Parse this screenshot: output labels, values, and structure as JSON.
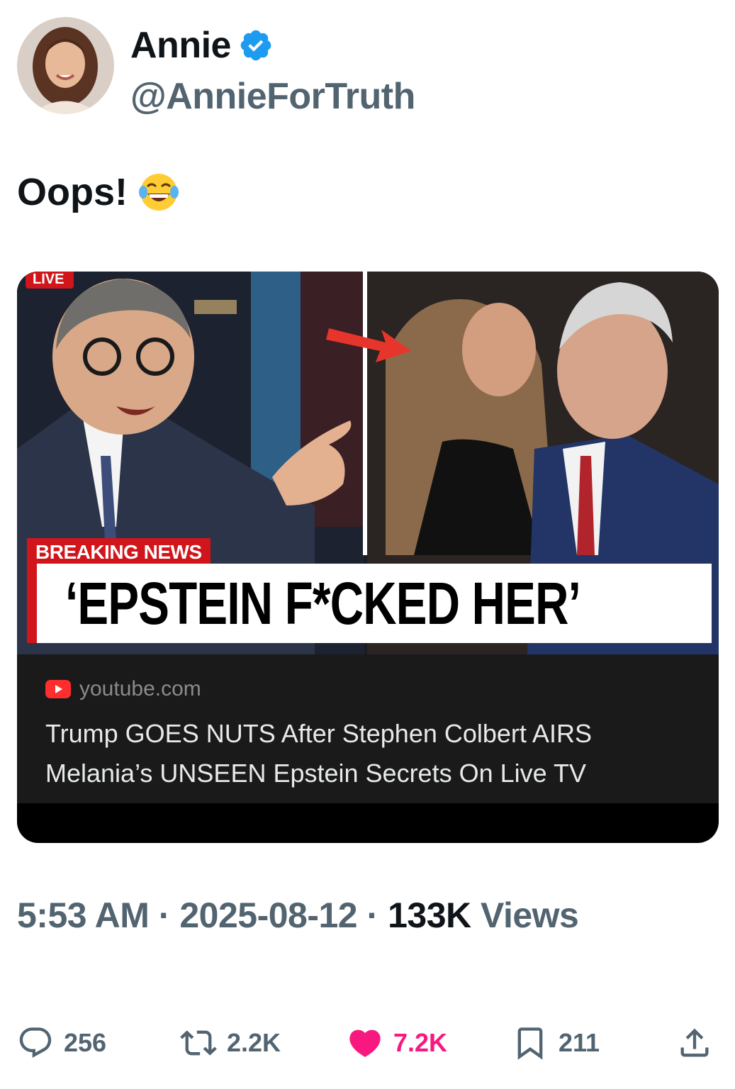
{
  "author": {
    "name": "Annie",
    "handle": "@AnnieForTruth",
    "verified": true,
    "verified_color": "#1d9bf0"
  },
  "tweet": {
    "text": "Oops!",
    "emoji": "face-with-tears-of-joy"
  },
  "card": {
    "thumbnail": {
      "live_label": "LIVE",
      "breaking_label": "BREAKING NEWS",
      "headline": "‘EPSTEIN F*CKED HER’"
    },
    "domain": "youtube.com",
    "title": "Trump GOES NUTS After Stephen Colbert AIRS Melania’s UNSEEN Epstein Secrets On Live TV"
  },
  "meta": {
    "time": "5:53 AM",
    "separator": "·",
    "date": "2025-08-12",
    "views_count": "133K",
    "views_label": "Views"
  },
  "actions": {
    "replies": "256",
    "reposts": "2.2K",
    "likes": "7.2K",
    "bookmarks": "211",
    "like_color": "#f91880"
  }
}
